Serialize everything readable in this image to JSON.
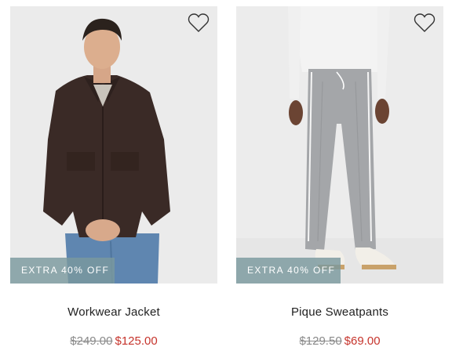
{
  "products": [
    {
      "name": "Workwear Jacket",
      "promo": "EXTRA 40% OFF",
      "original_price": "$249.00",
      "sale_price": "$125.00",
      "wishlist_icon": "heart-outline-icon"
    },
    {
      "name": "Pique Sweatpants",
      "promo": "EXTRA 40% OFF",
      "original_price": "$129.50",
      "sale_price": "$69.00",
      "wishlist_icon": "heart-outline-icon"
    }
  ],
  "colors": {
    "sale_price": "#c6342c",
    "original_price": "#8a8a8a",
    "promo_badge": "#7a989e",
    "text": "#222222"
  }
}
